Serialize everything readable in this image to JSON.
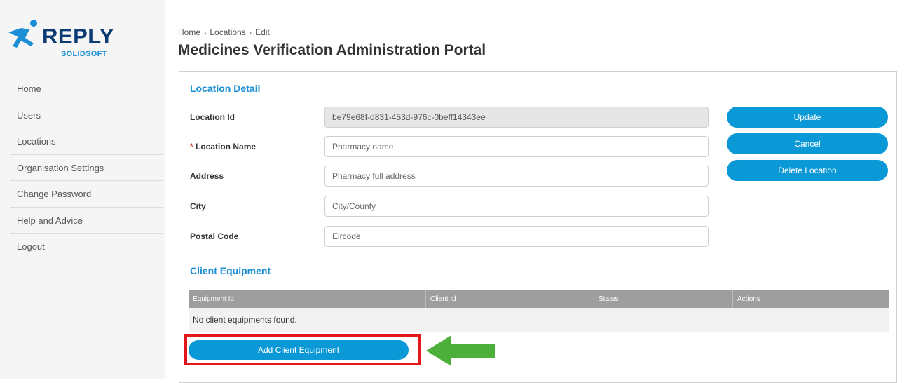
{
  "brand": {
    "name": "REPLY",
    "sub": "SOLIDSOFT",
    "primary_color": "#0a3b73",
    "accent_color": "#1a8fd6"
  },
  "nav": {
    "items": [
      "Home",
      "Users",
      "Locations",
      "Organisation Settings",
      "Change Password",
      "Help and Advice",
      "Logout"
    ]
  },
  "breadcrumb": {
    "items": [
      "Home",
      "Locations",
      "Edit"
    ],
    "separator_icon": "chevron-right-icon"
  },
  "page": {
    "title": "Medicines Verification Administration Portal"
  },
  "location_detail": {
    "section_title": "Location Detail",
    "location_id": {
      "label": "Location Id",
      "value": "be79e68f-d831-453d-976c-0beff14343ee"
    },
    "location_name": {
      "required_mark": "*",
      "label": "Location Name",
      "placeholder": "Pharmacy name"
    },
    "address": {
      "label": "Address",
      "placeholder": "Pharmacy full address"
    },
    "city": {
      "label": "City",
      "placeholder": "City/County"
    },
    "postal_code": {
      "label": "Postal Code",
      "placeholder": "Eircode"
    }
  },
  "actions": {
    "update": "Update",
    "cancel": "Cancel",
    "delete": "Delete Location",
    "button_color": "#0a99d6"
  },
  "client_equipment": {
    "section_title": "Client Equipment",
    "columns": [
      "Equipment Id",
      "Client Id",
      "Status",
      "Actions"
    ],
    "empty_message": "No client equipments found.",
    "add_button": "Add Client Equipment"
  },
  "annotation": {
    "highlight_color": "#e3161b",
    "arrow_color": "#4caf3a"
  }
}
